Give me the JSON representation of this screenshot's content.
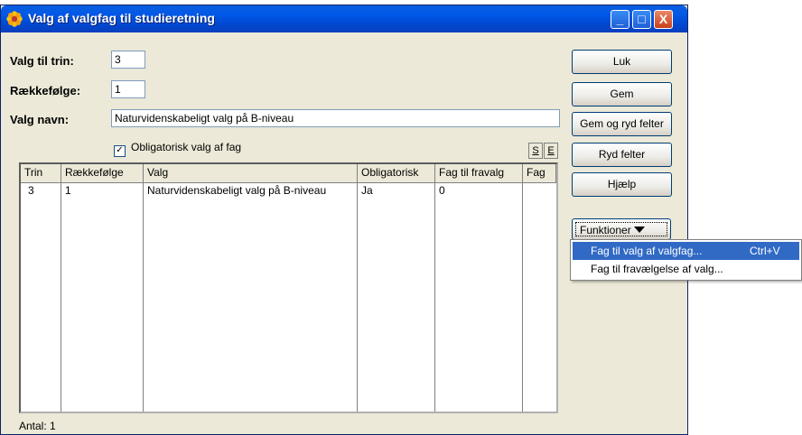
{
  "window": {
    "title": "Valg af valgfag til studieretning",
    "icon": "flower-icon"
  },
  "titlebar_buttons": {
    "minimize": "_",
    "maximize": "□",
    "close": "X"
  },
  "form": {
    "trin_label": "Valg til trin:",
    "trin_value": "3",
    "raekke_label": "Rækkefølge:",
    "raekke_value": "1",
    "navn_label": "Valg navn:",
    "navn_value": "Naturvidenskabeligt valg på B-niveau",
    "obligatorisk_label": "Obligatorisk valg af fag",
    "obligatorisk_checked": "✓",
    "s_button": "S",
    "e_button": "E"
  },
  "table": {
    "columns": [
      "Trin",
      "Rækkefølge",
      "Valg",
      "Obligatorisk",
      "Fag til fravalg",
      "Fag"
    ],
    "rows": [
      [
        "3",
        "1",
        "Naturvidenskabeligt valg på B-niveau",
        "Ja",
        "0",
        ""
      ]
    ]
  },
  "footer": {
    "count": "Antal: 1"
  },
  "buttons": {
    "luk": "Luk",
    "gem": "Gem",
    "gem_ryd": "Gem og ryd felter",
    "ryd": "Ryd felter",
    "hjaelp": "Hjælp",
    "funktioner": "Funktioner"
  },
  "menu": {
    "items": [
      {
        "label": "Fag til valg af valgfag...",
        "shortcut": "Ctrl+V"
      },
      {
        "label": "Fag til fravælgelse af valg...",
        "shortcut": ""
      }
    ]
  }
}
